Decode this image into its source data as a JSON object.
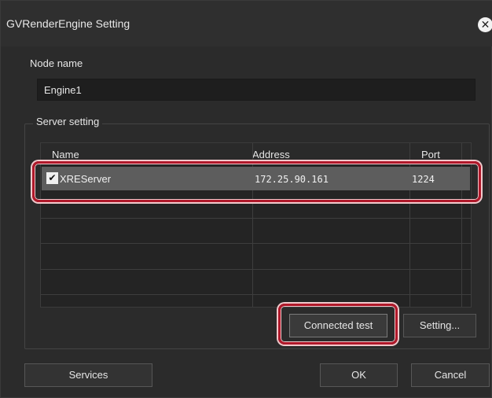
{
  "window": {
    "title": "GVRenderEngine Setting",
    "close_glyph": "✕"
  },
  "node": {
    "label": "Node name",
    "value": "Engine1"
  },
  "server": {
    "group_label": "Server setting",
    "columns": [
      "Name",
      "Address",
      "Port"
    ],
    "rows": [
      {
        "checked": true,
        "check_glyph": "✔",
        "name": "XREServer",
        "address": "172.25.90.161",
        "port": "1224"
      }
    ]
  },
  "buttons": {
    "connected_test": "Connected test",
    "setting": "Setting...",
    "services": "Services",
    "ok": "OK",
    "cancel": "Cancel"
  },
  "colors": {
    "background": "#2b2b2b",
    "selected_row": "#5d5d5d",
    "highlight": "#b0182a"
  },
  "icons": {
    "close": "close-icon",
    "check": "checkmark-icon"
  }
}
